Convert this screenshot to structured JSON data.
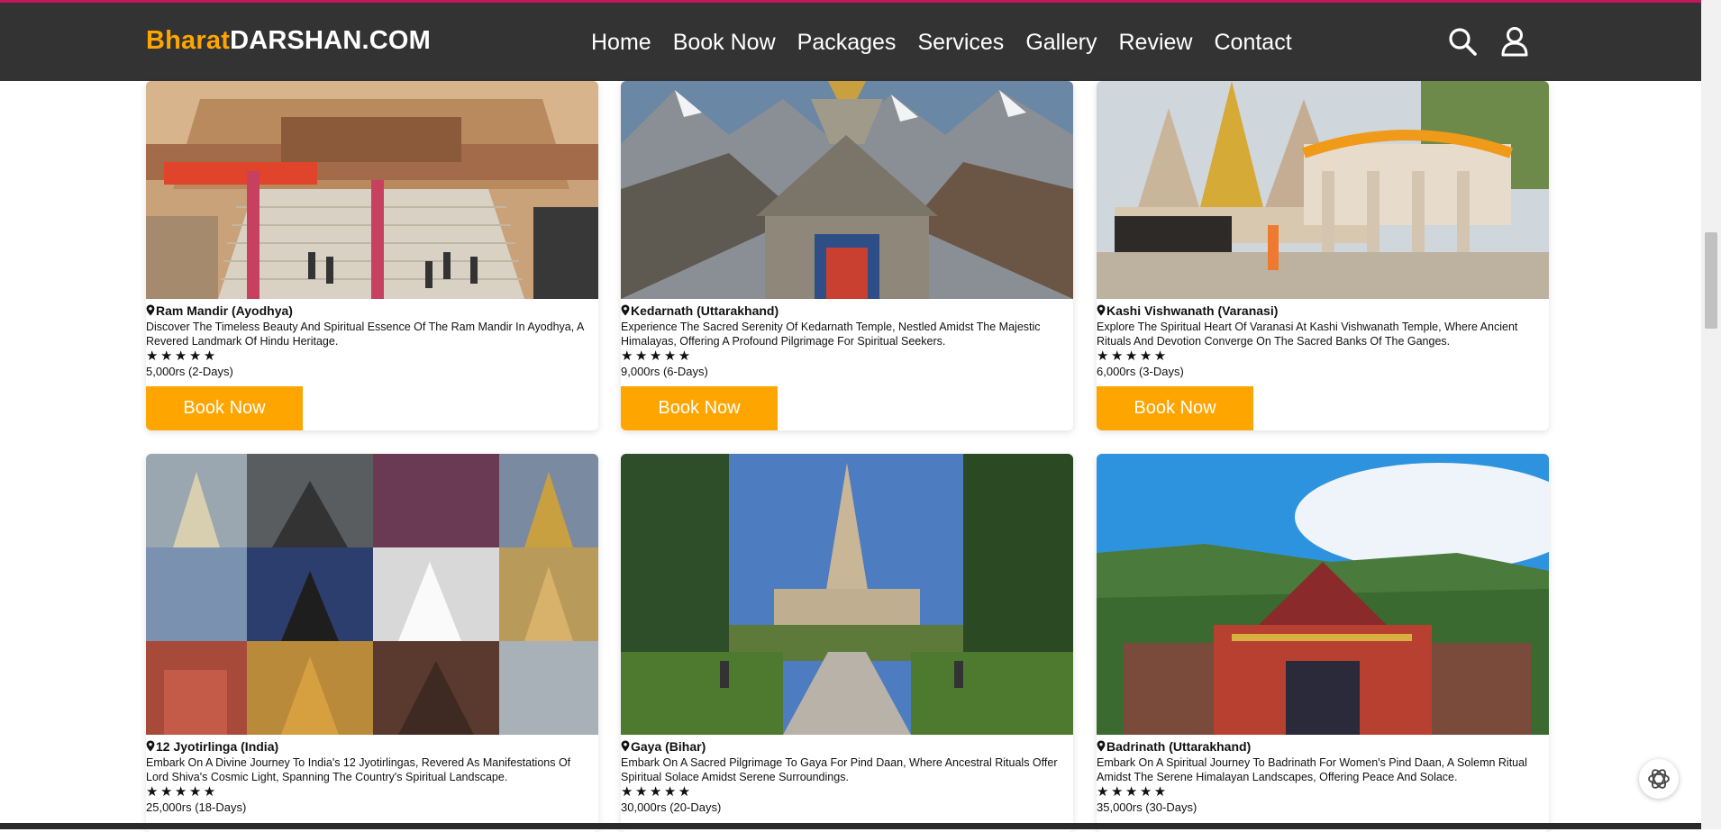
{
  "brand": {
    "part1": "Bharat",
    "part2": "DARSHAN.COM"
  },
  "nav": [
    "Home",
    "Book Now",
    "Packages",
    "Services",
    "Gallery",
    "Review",
    "Contact"
  ],
  "icons": {
    "search": "search-icon",
    "user": "user-icon",
    "location": "map-pin-icon",
    "assistant": "chatgpt-icon"
  },
  "colors": {
    "accent": "#ffa500",
    "navbar": "#333333",
    "top_border": "#c2185b"
  },
  "packages": [
    {
      "title": "Ram Mandir (Ayodhya)",
      "desc": "Discover The Timeless Beauty And Spiritual Essence Of The Ram Mandir In Ayodhya, A Revered Landmark Of Hindu Heritage.",
      "rating": 5,
      "stars": "★★★★★",
      "price": "5,000rs (2-Days)",
      "button": "Book Now",
      "image": "ram-mandir-photo"
    },
    {
      "title": "Kedarnath (Uttarakhand)",
      "desc": "Experience The Sacred Serenity Of Kedarnath Temple, Nestled Amidst The Majestic Himalayas, Offering A Profound Pilgrimage For Spiritual Seekers.",
      "rating": 5,
      "stars": "★★★★★",
      "price": "9,000rs (6-Days)",
      "button": "Book Now",
      "image": "kedarnath-photo"
    },
    {
      "title": "Kashi Vishwanath (Varanasi)",
      "desc": "Explore The Spiritual Heart Of Varanasi At Kashi Vishwanath Temple, Where Ancient Rituals And Devotion Converge On The Sacred Banks Of The Ganges.",
      "rating": 5,
      "stars": "★★★★★",
      "price": "6,000rs (3-Days)",
      "button": "Book Now",
      "image": "kashi-vishwanath-photo"
    },
    {
      "title": "12 Jyotirlinga (India)",
      "desc": "Embark On A Divine Journey To India's 12 Jyotirlingas, Revered As Manifestations Of Lord Shiva's Cosmic Light, Spanning The Country's Spiritual Landscape.",
      "rating": 5,
      "stars": "★★★★★",
      "price": "25,000rs (18-Days)",
      "image": "jyotirlinga-collage"
    },
    {
      "title": "Gaya (Bihar)",
      "desc": "Embark On A Sacred Pilgrimage To Gaya For Pind Daan, Where Ancestral Rituals Offer Spiritual Solace Amidst Serene Surroundings.",
      "rating": 5,
      "stars": "★★★★★",
      "price": "30,000rs (20-Days)",
      "image": "gaya-photo"
    },
    {
      "title": "Badrinath (Uttarakhand)",
      "desc": "Embark On A Spiritual Journey To Badrinath For Women's Pind Daan, A Solemn Ritual Amidst The Serene Himalayan Landscapes, Offering Peace And Solace.",
      "rating": 5,
      "stars": "★★★★★",
      "price": "35,000rs (30-Days)",
      "image": "badrinath-photo"
    }
  ]
}
